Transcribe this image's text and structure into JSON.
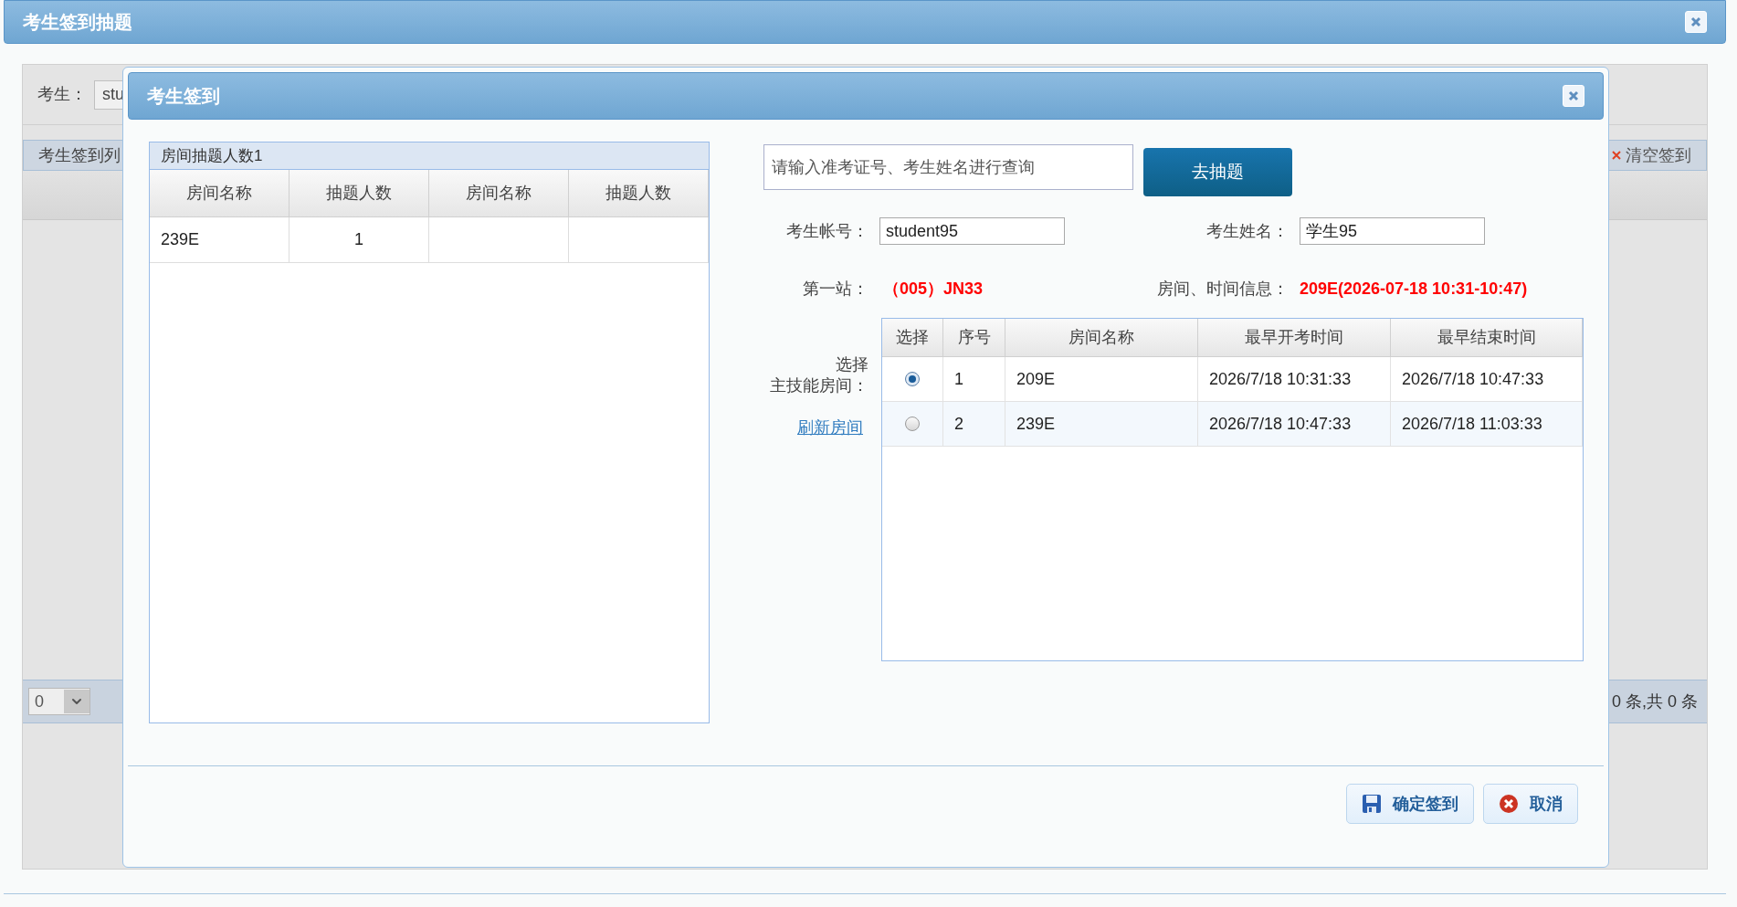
{
  "window": {
    "title": "考生签到抽题"
  },
  "background": {
    "filter_label": "考生：",
    "filter_value": "stu",
    "list_title": "考生签到列",
    "clear_button": "清空签到",
    "page_size": "0",
    "page_info": "0 条,共 0 条"
  },
  "dialog": {
    "title": "考生签到",
    "room_summary": {
      "title": "房间抽题人数1",
      "columns": [
        "房间名称",
        "抽题人数",
        "房间名称",
        "抽题人数"
      ],
      "rows": [
        {
          "cells": [
            "239E",
            "1"
          ]
        }
      ]
    },
    "search": {
      "placeholder": "请输入准考证号、考生姓名进行查询"
    },
    "draw_button": "去抽题",
    "fields": [
      {
        "label": "考生帐号：",
        "value": "student95"
      },
      {
        "label": "考生姓名：",
        "value": "学生95"
      }
    ],
    "info": [
      {
        "label": "第一站：",
        "value": "（005）JN33"
      },
      {
        "label": "房间、时间信息：",
        "value": "209E(2026-07-18 10:31-10:47)"
      }
    ],
    "room_label": [
      "选择",
      "主技能房间："
    ],
    "refresh_link": "刷新房间",
    "rooms": {
      "select_column": "选择",
      "columns": [
        "序号",
        "房间名称",
        "最早开考时间",
        "最早结束时间"
      ],
      "rows": [
        {
          "selected": true,
          "cells": [
            "1",
            "209E",
            "2026/7/18 10:31:33",
            "2026/7/18 10:47:33"
          ]
        },
        {
          "selected": false,
          "cells": [
            "2",
            "239E",
            "2026/7/18 10:47:33",
            "2026/7/18 11:03:33"
          ]
        }
      ]
    },
    "buttons": [
      {
        "kind": "save",
        "label": "确定签到"
      },
      {
        "kind": "cancel",
        "label": "取消"
      }
    ]
  }
}
